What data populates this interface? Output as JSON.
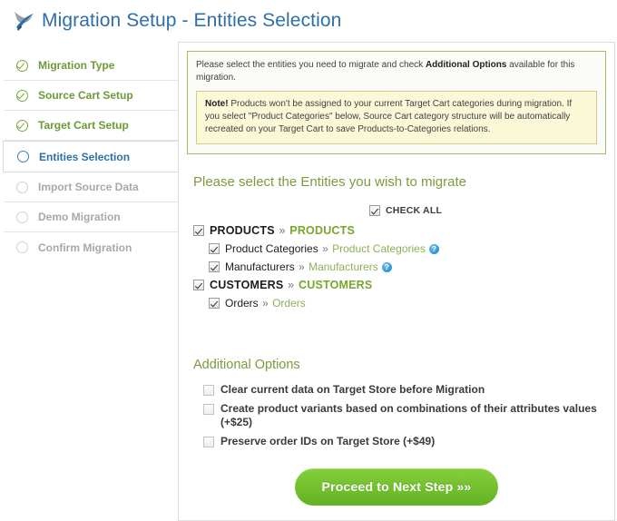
{
  "header": {
    "title": "Migration Setup - Entities Selection",
    "logo_icon": "swoosh-logo-icon"
  },
  "sidebar": {
    "steps": [
      {
        "label": "Migration Type",
        "state": "done"
      },
      {
        "label": "Source Cart Setup",
        "state": "done"
      },
      {
        "label": "Target Cart Setup",
        "state": "done"
      },
      {
        "label": "Entities Selection",
        "state": "active"
      },
      {
        "label": "Import Source Data",
        "state": "pending"
      },
      {
        "label": "Demo Migration",
        "state": "pending"
      },
      {
        "label": "Confirm Migration",
        "state": "pending"
      }
    ]
  },
  "info": {
    "intro_before": "Please select the entities you need to migrate and check ",
    "intro_bold": "Additional Options",
    "intro_after": " available for this migration.",
    "note_bold": "Note!",
    "note_text": " Products won't be assigned to your current Target Cart categories during migration. If you select \"Product Categories\" below, Source Cart category structure will be automatically recreated on your Target Cart to save Products-to-Categories relations."
  },
  "entities_section": {
    "heading": "Please select the Entities you wish to migrate",
    "check_all_label": "CHECK ALL",
    "check_all_checked": true,
    "items": [
      {
        "source": "PRODUCTS",
        "separator": "»",
        "target": "PRODUCTS",
        "checked": true,
        "level": "group",
        "help": false
      },
      {
        "source": "Product Categories",
        "separator": "»",
        "target": "Product Categories",
        "checked": true,
        "level": "sub",
        "help": true
      },
      {
        "source": "Manufacturers",
        "separator": "»",
        "target": "Manufacturers",
        "checked": true,
        "level": "sub",
        "help": true
      },
      {
        "source": "CUSTOMERS",
        "separator": "»",
        "target": "CUSTOMERS",
        "checked": true,
        "level": "group",
        "help": false
      },
      {
        "source": "Orders",
        "separator": "»",
        "target": "Orders",
        "checked": true,
        "level": "sub",
        "help": false
      }
    ]
  },
  "additional_options": {
    "heading": "Additional Options",
    "options": [
      {
        "label": "Clear current data on Target Store before Migration",
        "checked": false
      },
      {
        "label": "Create product variants based on combinations of their attributes values (+$25)",
        "checked": false
      },
      {
        "label": "Preserve order IDs on Target Store (+$49)",
        "checked": false
      }
    ]
  },
  "footer": {
    "proceed_label": "Proceed to Next Step »»"
  },
  "colors": {
    "title_blue": "#2f6fa8",
    "green_accent": "#7d9b3c",
    "button_green": "#63b223",
    "note_yellow": "#fbf8d8",
    "step_done": "#6d9a36"
  }
}
